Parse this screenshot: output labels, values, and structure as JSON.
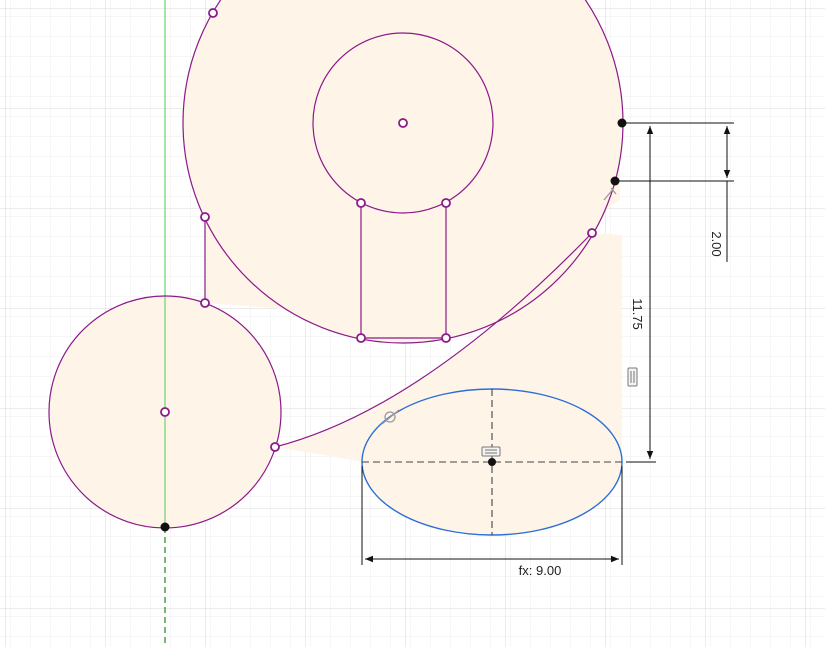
{
  "canvas": {
    "background": "#ffffff",
    "grid_minor_color": "#e9e9e9",
    "grid_major_color": "#d6d6d6"
  },
  "colors": {
    "profile_fill": "#fff4e8",
    "sketch_line": "#8b1a89",
    "selected_line": "#2b6fd6",
    "axis_green": "#7ed87e",
    "dimension_line": "#111111",
    "point_fill": "#ffffff",
    "fixed_point": "#111111"
  },
  "dimensions": {
    "horizontal_offset": "2.00",
    "vertical_distance": "11.75",
    "ellipse_width": "fx: 9.00"
  },
  "icons": {
    "tangent_constraint": "tangent-icon",
    "horizontal_constraint": "horizontal-constraint-icon",
    "vertical_constraint": "vertical-constraint-icon",
    "coincident_constraint": "coincident-icon"
  }
}
